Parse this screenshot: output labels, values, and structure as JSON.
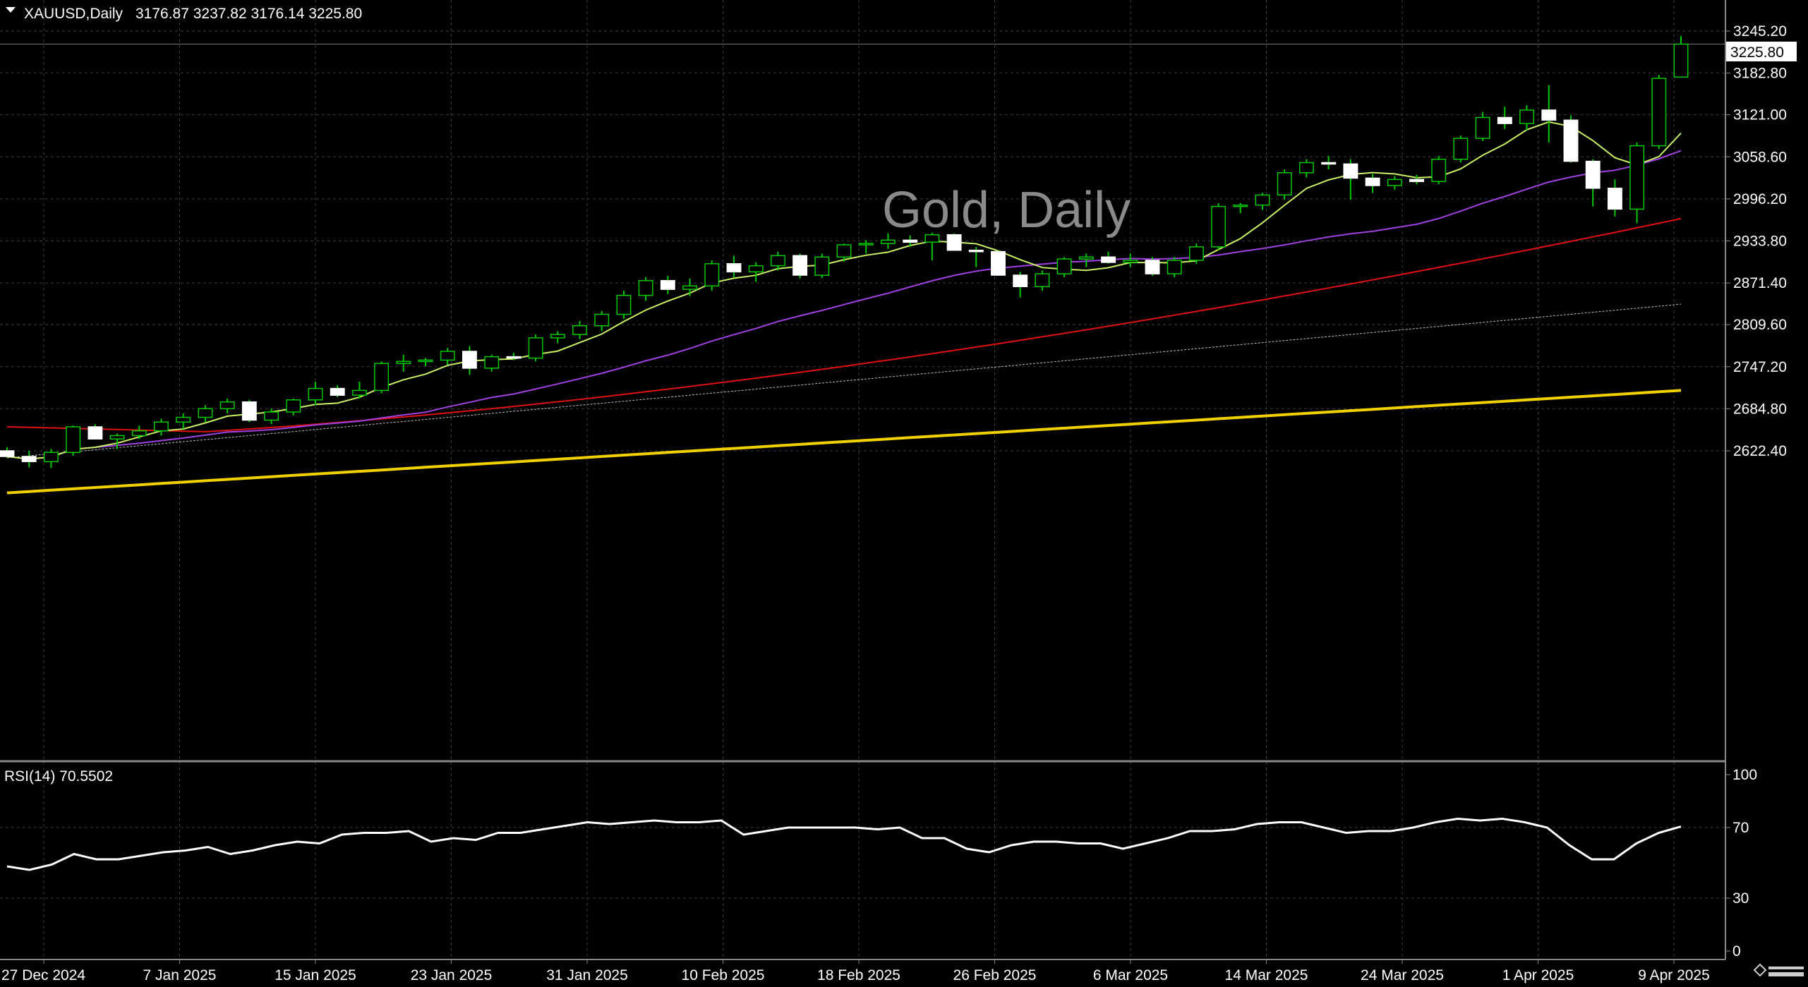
{
  "header": {
    "symbol": "XAUUSD,Daily",
    "ohlc": "3176.87 3237.82 3176.14 3225.80",
    "watermark": "Gold, Daily"
  },
  "rsi": {
    "label": "RSI(14) 70.5502",
    "levels": [
      "100",
      "70",
      "30",
      "0"
    ]
  },
  "price_axis": {
    "ticks": [
      "3245.20",
      "3182.80",
      "3121.00",
      "3058.60",
      "2996.20",
      "2933.80",
      "2871.40",
      "2809.60",
      "2747.20",
      "2684.80",
      "2622.40"
    ],
    "current_price": "3225.80"
  },
  "date_axis": {
    "ticks": [
      "27 Dec 2024",
      "7 Jan 2025",
      "15 Jan 2025",
      "23 Jan 2025",
      "31 Jan 2025",
      "10 Feb 2025",
      "18 Feb 2025",
      "26 Feb 2025",
      "6 Mar 2025",
      "14 Mar 2025",
      "24 Mar 2025",
      "1 Apr 2025",
      "9 Apr 2025"
    ]
  },
  "colors": {
    "background": "#000000",
    "grid": "#3a3a3a",
    "bull_candle": "#000000",
    "bear_candle": "#ffffff",
    "wick": "#00c800",
    "ma_fast": "#c8f064",
    "ma_mid": "#a040e0",
    "ma_slow": "#e01010",
    "ma_100": "#c0c0c0",
    "ma_200": "#f0d000",
    "rsi_line": "#ffffff"
  },
  "chart_data": {
    "type": "candlestick",
    "ylim": [
      2600,
      3262
    ],
    "rsi_ylim": [
      0,
      100
    ],
    "candles": [
      [
        2622.4,
        2627.6,
        2612.0,
        2614.0
      ],
      [
        2614.0,
        2622.4,
        2598.0,
        2606.4
      ],
      [
        2606.4,
        2625.0,
        2597.0,
        2620.0
      ],
      [
        2620.0,
        2660.0,
        2615.0,
        2658.0
      ],
      [
        2658.0,
        2662.0,
        2640.0,
        2640.0
      ],
      [
        2640.0,
        2648.0,
        2625.0,
        2645.0
      ],
      [
        2645.0,
        2660.0,
        2640.0,
        2652.0
      ],
      [
        2652.0,
        2670.0,
        2645.0,
        2665.0
      ],
      [
        2665.0,
        2678.0,
        2655.0,
        2672.0
      ],
      [
        2672.0,
        2690.0,
        2665.0,
        2685.0
      ],
      [
        2685.0,
        2700.0,
        2678.0,
        2695.0
      ],
      [
        2695.0,
        2698.0,
        2665.0,
        2668.0
      ],
      [
        2668.0,
        2685.0,
        2662.0,
        2680.0
      ],
      [
        2680.0,
        2700.0,
        2675.0,
        2698.0
      ],
      [
        2698.0,
        2725.0,
        2690.0,
        2715.0
      ],
      [
        2715.0,
        2720.0,
        2702.0,
        2705.0
      ],
      [
        2705.0,
        2725.0,
        2700.0,
        2712.0
      ],
      [
        2712.0,
        2755.0,
        2708.0,
        2752.0
      ],
      [
        2752.0,
        2765.0,
        2740.0,
        2755.0
      ],
      [
        2755.0,
        2760.0,
        2748.0,
        2757.0
      ],
      [
        2757.0,
        2775.0,
        2750.0,
        2770.0
      ],
      [
        2770.0,
        2778.0,
        2735.0,
        2745.0
      ],
      [
        2745.0,
        2765.0,
        2740.0,
        2762.0
      ],
      [
        2762.0,
        2768.0,
        2757.0,
        2760.0
      ],
      [
        2760.0,
        2795.0,
        2755.0,
        2790.0
      ],
      [
        2790.0,
        2800.0,
        2782.0,
        2795.0
      ],
      [
        2795.0,
        2815.0,
        2788.0,
        2808.0
      ],
      [
        2808.0,
        2830.0,
        2800.0,
        2825.0
      ],
      [
        2825.0,
        2860.0,
        2818.0,
        2853.0
      ],
      [
        2853.0,
        2880.0,
        2845.0,
        2875.0
      ],
      [
        2875.0,
        2882.0,
        2855.0,
        2862.0
      ],
      [
        2862.0,
        2878.0,
        2852.0,
        2867.0
      ],
      [
        2867.0,
        2905.0,
        2860.0,
        2900.0
      ],
      [
        2900.0,
        2912.0,
        2880.0,
        2888.0
      ],
      [
        2888.0,
        2902.0,
        2873.0,
        2897.0
      ],
      [
        2897.0,
        2918.0,
        2890.0,
        2912.0
      ],
      [
        2912.0,
        2915.0,
        2878.0,
        2883.0
      ],
      [
        2883.0,
        2915.0,
        2879.0,
        2910.0
      ],
      [
        2910.0,
        2930.0,
        2903.0,
        2928.0
      ],
      [
        2928.0,
        2935.0,
        2915.0,
        2930.0
      ],
      [
        2930.0,
        2945.0,
        2922.0,
        2935.0
      ],
      [
        2935.0,
        2942.0,
        2925.0,
        2932.0
      ],
      [
        2932.0,
        2946.0,
        2905.0,
        2943.0
      ],
      [
        2943.0,
        2945.0,
        2920.0,
        2920.0
      ],
      [
        2920.0,
        2925.0,
        2895.0,
        2918.0
      ],
      [
        2918.0,
        2920.0,
        2882.0,
        2883.0
      ],
      [
        2883.0,
        2888.0,
        2850.0,
        2866.0
      ],
      [
        2866.0,
        2890.0,
        2860.0,
        2885.0
      ],
      [
        2885.0,
        2910.0,
        2880.0,
        2907.0
      ],
      [
        2907.0,
        2915.0,
        2895.0,
        2910.0
      ],
      [
        2910.0,
        2918.0,
        2900.0,
        2902.0
      ],
      [
        2902.0,
        2915.0,
        2895.0,
        2905.0
      ],
      [
        2905.0,
        2910.0,
        2882.0,
        2885.0
      ],
      [
        2885.0,
        2910.0,
        2880.0,
        2905.0
      ],
      [
        2905.0,
        2930.0,
        2900.0,
        2925.0
      ],
      [
        2925.0,
        2990.0,
        2920.0,
        2985.0
      ],
      [
        2985.0,
        2990.0,
        2975.0,
        2987.0
      ],
      [
        2987.0,
        3005.0,
        2980.0,
        3002.0
      ],
      [
        3002.0,
        3040.0,
        2995.0,
        3035.0
      ],
      [
        3035.0,
        3055.0,
        3028.0,
        3050.0
      ],
      [
        3050.0,
        3060.0,
        3040.0,
        3048.0
      ],
      [
        3048.0,
        3055.0,
        2995.0,
        3027.0
      ],
      [
        3027.0,
        3033.0,
        3005.0,
        3016.0
      ],
      [
        3016.0,
        3030.0,
        3010.0,
        3025.0
      ],
      [
        3025.0,
        3032.0,
        3018.0,
        3022.0
      ],
      [
        3022.0,
        3060.0,
        3018.0,
        3055.0
      ],
      [
        3055.0,
        3090.0,
        3050.0,
        3086.0
      ],
      [
        3086.0,
        3125.0,
        3082.0,
        3117.0
      ],
      [
        3117.0,
        3133.0,
        3100.0,
        3108.0
      ],
      [
        3108.0,
        3135.0,
        3098.0,
        3128.0
      ],
      [
        3128.0,
        3165.0,
        3080.0,
        3113.0
      ],
      [
        3113.0,
        3120.0,
        3050.0,
        3052.0
      ],
      [
        3052.0,
        3055.0,
        2985.0,
        3012.0
      ],
      [
        3012.0,
        3025.0,
        2970.0,
        2981.0
      ],
      [
        2981.0,
        3080.0,
        2960.0,
        3075.0
      ],
      [
        3075.0,
        3180.0,
        3070.0,
        3175.0
      ],
      [
        3176.87,
        3237.82,
        3176.14,
        3225.8
      ]
    ],
    "rsi_values": [
      48,
      46,
      49,
      55,
      52,
      52,
      54,
      56,
      57,
      59,
      55,
      57,
      60,
      62,
      61,
      66,
      67,
      67,
      68,
      62,
      64,
      63,
      67,
      67,
      69,
      71,
      73,
      72,
      73,
      74,
      73,
      73,
      74,
      66,
      68,
      70,
      70,
      70,
      70,
      69,
      70,
      64,
      64,
      58,
      56,
      60,
      62,
      62,
      61,
      61,
      58,
      61,
      64,
      68,
      68,
      69,
      72,
      73,
      73,
      70,
      67,
      68,
      68,
      70,
      73,
      75,
      74,
      75,
      73,
      70,
      60,
      52,
      52,
      61,
      67,
      70.5502
    ],
    "ma_labels": []
  }
}
